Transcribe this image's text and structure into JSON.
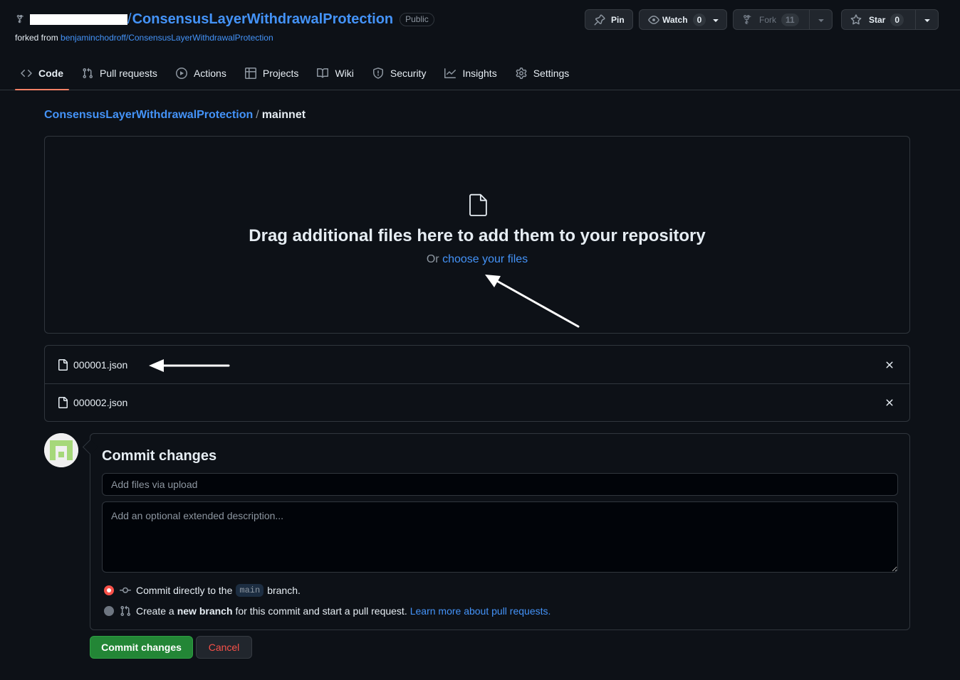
{
  "repo": {
    "name": "ConsensusLayerWithdrawalProtection",
    "visibility": "Public",
    "forked_from_prefix": "forked from",
    "forked_from": "benjaminchodroff/ConsensusLayerWithdrawalProtection"
  },
  "actions": {
    "pin": "Pin",
    "watch": "Watch",
    "watch_count": "0",
    "fork": "Fork",
    "fork_count": "11",
    "star": "Star",
    "star_count": "0"
  },
  "tabs": [
    {
      "label": "Code",
      "icon": "code-icon"
    },
    {
      "label": "Pull requests",
      "icon": "git-pull-request-icon"
    },
    {
      "label": "Actions",
      "icon": "play-icon"
    },
    {
      "label": "Projects",
      "icon": "table-icon"
    },
    {
      "label": "Wiki",
      "icon": "book-icon"
    },
    {
      "label": "Security",
      "icon": "shield-icon"
    },
    {
      "label": "Insights",
      "icon": "graph-icon"
    },
    {
      "label": "Settings",
      "icon": "gear-icon"
    }
  ],
  "breadcrumb": {
    "repo": "ConsensusLayerWithdrawalProtection",
    "separator": "/",
    "current": "mainnet"
  },
  "dropzone": {
    "title": "Drag additional files here to add them to your repository",
    "sub_prefix": "Or",
    "choose_link": "choose your files"
  },
  "files": [
    {
      "name": "000001.json"
    },
    {
      "name": "000002.json"
    }
  ],
  "commit": {
    "title": "Commit changes",
    "summary_placeholder": "Add files via upload",
    "description_placeholder": "Add an optional extended description...",
    "direct_prefix": "Commit directly to the",
    "branch": "main",
    "direct_suffix": "branch.",
    "new_prefix": "Create a",
    "new_bold": "new branch",
    "new_suffix": "for this commit and start a pull request.",
    "learn_more": "Learn more about pull requests.",
    "submit": "Commit changes",
    "cancel": "Cancel"
  },
  "colors": {
    "background": "#0d1117",
    "link": "#4493f8",
    "border": "#30363d",
    "primary_button": "#238636",
    "danger": "#f85149",
    "tab_underline": "#f78166"
  }
}
